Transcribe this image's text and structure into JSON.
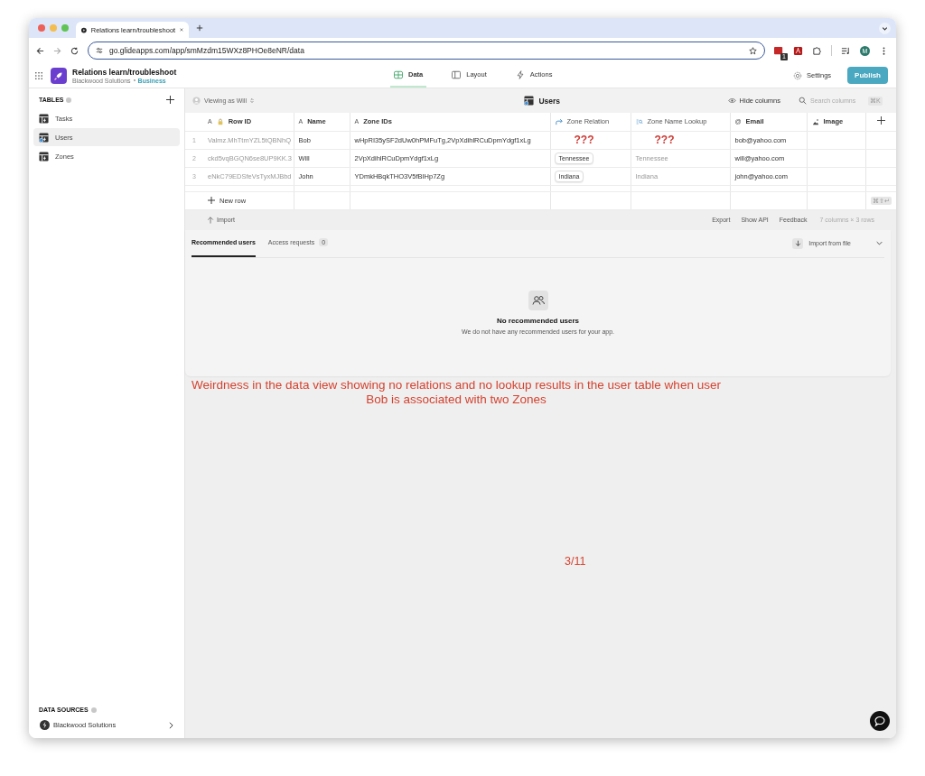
{
  "browser": {
    "tab_title": "Relations learn/troubleshoot",
    "url": "go.glideapps.com/app/smMzdm15WXz8PHOe8eNR/data",
    "extension_badge": "1",
    "profile_initial": "M"
  },
  "app": {
    "name": "Relations learn/troubleshoot",
    "org": "Blackwood Solutions",
    "plan": "Business",
    "nav": [
      {
        "label": "Data",
        "kind": "data",
        "selected": true
      },
      {
        "label": "Layout",
        "kind": "layout",
        "selected": false
      },
      {
        "label": "Actions",
        "kind": "actions",
        "selected": false
      }
    ],
    "settings": "Settings",
    "publish": "Publish"
  },
  "sidebar": {
    "tables_heading": "TABLES",
    "tables": [
      {
        "label": "Tasks",
        "user_table": false,
        "selected": false
      },
      {
        "label": "Users",
        "user_table": true,
        "selected": true
      },
      {
        "label": "Zones",
        "user_table": false,
        "selected": false
      }
    ],
    "sources_heading": "DATA SOURCES",
    "source": "Blackwood Solutions"
  },
  "toolbar": {
    "viewing_as": "Viewing as Will",
    "table_title": "Users",
    "hide_columns": "Hide columns",
    "search_placeholder": "Search columns",
    "search_shortcut": "⌘K"
  },
  "table": {
    "columns": [
      {
        "label": "Row ID",
        "kind": "text",
        "glyph": "A",
        "locked": true
      },
      {
        "label": "Name",
        "kind": "text",
        "glyph": "A",
        "locked": false
      },
      {
        "label": "Zone IDs",
        "kind": "text",
        "glyph": "A",
        "locked": false
      },
      {
        "label": "Zone Relation",
        "kind": "relation",
        "locked": false
      },
      {
        "label": "Zone Name Lookup",
        "kind": "lookup",
        "locked": false
      },
      {
        "label": "Email",
        "kind": "email",
        "glyph": "@",
        "locked": false
      },
      {
        "label": "Image",
        "kind": "image",
        "locked": false
      }
    ],
    "rows": [
      {
        "number": "1",
        "cells": [
          {
            "kind": "muted",
            "text": "Valmz.MhTtmYZL5tQBNhQ"
          },
          {
            "kind": "text",
            "text": "Bob"
          },
          {
            "kind": "text",
            "text": "wHpRI35ySF2dUw0hPMFuTg,2VpXdihlRCuDpmYdgf1xLg"
          },
          {
            "kind": "flag",
            "text": "???"
          },
          {
            "kind": "flag",
            "text": "???"
          },
          {
            "kind": "text",
            "text": "bob@yahoo.com"
          },
          {
            "kind": "empty"
          }
        ]
      },
      {
        "number": "2",
        "cells": [
          {
            "kind": "muted",
            "text": "ckd5vqBGQN6se8UP9KK.3"
          },
          {
            "kind": "text",
            "text": "Will"
          },
          {
            "kind": "text",
            "text": "2VpXdihlRCuDpmYdgf1xLg"
          },
          {
            "kind": "chip",
            "text": "Tennessee"
          },
          {
            "kind": "muted",
            "text": "Tennessee"
          },
          {
            "kind": "text",
            "text": "will@yahoo.com"
          },
          {
            "kind": "empty"
          }
        ]
      },
      {
        "number": "3",
        "cells": [
          {
            "kind": "muted",
            "text": "eNkC79EDSfeVsTyxMJBbd"
          },
          {
            "kind": "text",
            "text": "John"
          },
          {
            "kind": "text",
            "text": "YDmkHBqkTHO3V5fBIHp7Zg"
          },
          {
            "kind": "chip",
            "text": "Indiana"
          },
          {
            "kind": "muted",
            "text": "Indiana"
          },
          {
            "kind": "text",
            "text": "john@yahoo.com"
          },
          {
            "kind": "empty"
          }
        ]
      }
    ],
    "new_row": "New row",
    "new_row_shortcut": "⌘⇧↵"
  },
  "footer": {
    "import": "Import",
    "links": [
      "Export",
      "Show API",
      "Feedback"
    ],
    "summary": "7 columns × 3 rows"
  },
  "users_panel": {
    "tabs": [
      {
        "label": "Recommended users",
        "selected": true
      },
      {
        "label": "Access requests",
        "count": "0",
        "selected": false
      }
    ],
    "import_button": "Import from file",
    "empty_title": "No recommended users",
    "empty_text": "We do not have any recommended users for your app."
  },
  "annotation": {
    "note": "Weirdness in the data view showing no relations and no lookup results in the user table when user Bob is associated with two Zones",
    "page": "3/11"
  }
}
